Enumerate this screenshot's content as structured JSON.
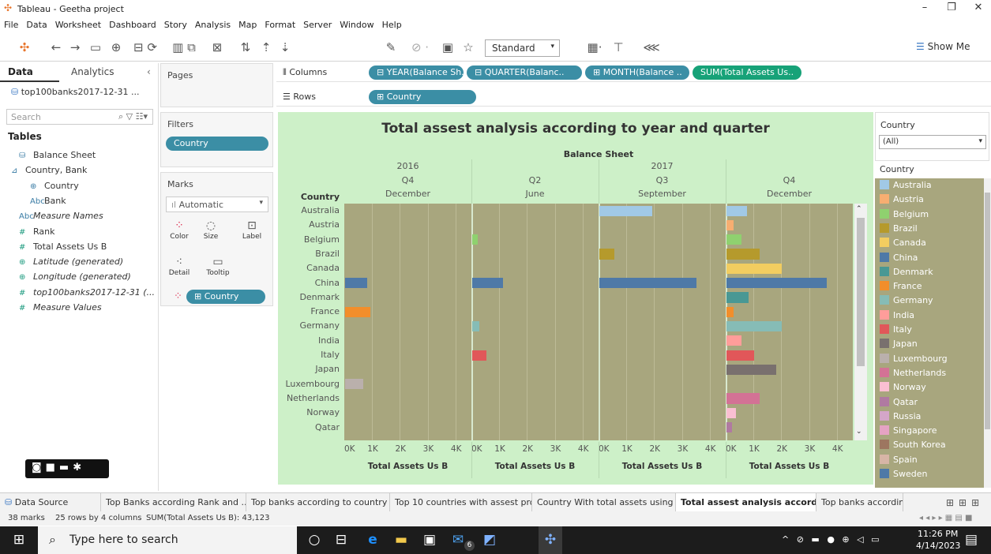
{
  "window": {
    "title": "Tableau - Geetha project"
  },
  "menu": [
    "File",
    "Data",
    "Worksheet",
    "Dashboard",
    "Story",
    "Analysis",
    "Map",
    "Format",
    "Server",
    "Window",
    "Help"
  ],
  "toolbar": {
    "fit": "Standard",
    "show_me": "Show Me"
  },
  "left_panel": {
    "tab_data": "Data",
    "tab_analytics": "Analytics",
    "datasource": "top100banks2017-12-31 ...",
    "search_placeholder": "Search",
    "tables_heading": "Tables",
    "fields": [
      {
        "icon": "table-icon",
        "label": "Balance Sheet",
        "italic": false,
        "measure": false
      },
      {
        "icon": "hierarchy-icon",
        "label": "Country, Bank",
        "italic": false,
        "measure": false
      },
      {
        "icon": "globe-icon",
        "label": "Country",
        "italic": false,
        "measure": false
      },
      {
        "icon": "abc-icon",
        "label": "Bank",
        "italic": false,
        "measure": false
      },
      {
        "icon": "abc-icon",
        "label": "Measure Names",
        "italic": true,
        "measure": false
      },
      {
        "icon": "number-icon",
        "label": "Rank",
        "italic": false,
        "measure": true
      },
      {
        "icon": "number-icon",
        "label": "Total Assets Us B",
        "italic": false,
        "measure": true
      },
      {
        "icon": "globe-icon",
        "label": "Latitude (generated)",
        "italic": true,
        "measure": true
      },
      {
        "icon": "globe-icon",
        "label": "Longitude (generated)",
        "italic": true,
        "measure": true
      },
      {
        "icon": "number-icon",
        "label": "top100banks2017-12-31 (...",
        "italic": true,
        "measure": true
      },
      {
        "icon": "number-icon",
        "label": "Measure Values",
        "italic": true,
        "measure": true
      }
    ]
  },
  "cards": {
    "pages": "Pages",
    "filters": "Filters",
    "filter_pill": "Country",
    "marks": "Marks",
    "mark_type": "Automatic",
    "mark_buttons": [
      "Color",
      "Size",
      "Label",
      "Detail",
      "Tooltip"
    ],
    "marks_pill": "Country"
  },
  "shelves": {
    "columns_label": "Columns",
    "rows_label": "Rows",
    "columns": [
      "YEAR(Balance Sh..",
      "QUARTER(Balanc..",
      "MONTH(Balance ..",
      "SUM(Total Assets Us.."
    ],
    "rows": [
      "Country"
    ]
  },
  "chart_data": {
    "type": "bar",
    "title": "Total assest analysis according to year and quarter",
    "header_title": "Balance Sheet",
    "row_header": "Country",
    "panes": [
      {
        "year": "2016",
        "quarter": "Q4",
        "month": "December"
      },
      {
        "year": "",
        "quarter": "Q2",
        "month": "June"
      },
      {
        "year": "2017",
        "quarter": "Q3",
        "month": "September"
      },
      {
        "year": "",
        "quarter": "Q4",
        "month": "December"
      }
    ],
    "year_headers": [
      "2016",
      "2017"
    ],
    "categories": [
      "Australia",
      "Austria",
      "Belgium",
      "Brazil",
      "Canada",
      "China",
      "Denmark",
      "France",
      "Germany",
      "India",
      "Italy",
      "Japan",
      "Luxembourg",
      "Netherlands",
      "Norway",
      "Qatar"
    ],
    "colors": [
      "#a1c9e6",
      "#f7ae71",
      "#8fd16f",
      "#b59a2c",
      "#f2cd60",
      "#4e79a7",
      "#499894",
      "#f28e2b",
      "#86bcb6",
      "#ff9d9a",
      "#e15759",
      "#79706e",
      "#bab0ac",
      "#d37295",
      "#fabfd2",
      "#b07aa1"
    ],
    "series": [
      {
        "name": "2016 Q4 December",
        "values": [
          0,
          0,
          0,
          0,
          0,
          800,
          0,
          900,
          0,
          0,
          0,
          0,
          650,
          0,
          0,
          0
        ]
      },
      {
        "name": "2017 Q2 June",
        "values": [
          0,
          0,
          200,
          0,
          0,
          1100,
          0,
          0,
          250,
          0,
          500,
          0,
          0,
          0,
          0,
          0
        ]
      },
      {
        "name": "2017 Q3 September",
        "values": [
          1900,
          0,
          0,
          550,
          0,
          3500,
          0,
          0,
          0,
          0,
          0,
          0,
          0,
          0,
          0,
          0
        ]
      },
      {
        "name": "2017 Q4 December",
        "values": [
          750,
          250,
          550,
          1200,
          2000,
          3600,
          800,
          250,
          2000,
          550,
          1000,
          1800,
          0,
          1200,
          350,
          200
        ]
      }
    ],
    "xlim": [
      0,
      4400
    ],
    "x_ticks": [
      "0K",
      "1K",
      "2K",
      "3K",
      "4K"
    ],
    "x_tick_values": [
      0,
      1000,
      2000,
      3000,
      4000
    ],
    "xlabel": "Total Assets Us B",
    "ylabel": "Country"
  },
  "legend": {
    "title": "Country",
    "filter_title": "Country",
    "filter_value": "(All)",
    "items": [
      {
        "label": "Australia",
        "color": "#a1c9e6"
      },
      {
        "label": "Austria",
        "color": "#f7ae71"
      },
      {
        "label": "Belgium",
        "color": "#8fd16f"
      },
      {
        "label": "Brazil",
        "color": "#b59a2c"
      },
      {
        "label": "Canada",
        "color": "#f2cd60"
      },
      {
        "label": "China",
        "color": "#4e79a7"
      },
      {
        "label": "Denmark",
        "color": "#499894"
      },
      {
        "label": "France",
        "color": "#f28e2b"
      },
      {
        "label": "Germany",
        "color": "#86bcb6"
      },
      {
        "label": "India",
        "color": "#ff9d9a"
      },
      {
        "label": "Italy",
        "color": "#e15759"
      },
      {
        "label": "Japan",
        "color": "#79706e"
      },
      {
        "label": "Luxembourg",
        "color": "#bab0ac"
      },
      {
        "label": "Netherlands",
        "color": "#d37295"
      },
      {
        "label": "Norway",
        "color": "#fabfd2"
      },
      {
        "label": "Qatar",
        "color": "#b07aa1"
      },
      {
        "label": "Russia",
        "color": "#d4a6c8"
      },
      {
        "label": "Singapore",
        "color": "#e5a3c3"
      },
      {
        "label": "South Korea",
        "color": "#9d7660"
      },
      {
        "label": "Spain",
        "color": "#d7b5a6"
      },
      {
        "label": "Sweden",
        "color": "#4e79a7"
      }
    ]
  },
  "sheet_tabs": [
    {
      "label": "Data Source",
      "active": false
    },
    {
      "label": "Top Banks according Rank and ...",
      "active": false
    },
    {
      "label": "Top banks according to country ...",
      "active": false
    },
    {
      "label": "Top 10 countries with assest pro...",
      "active": false
    },
    {
      "label": "Country With total assets using f...",
      "active": false
    },
    {
      "label": "Total assest analysis accordin...",
      "active": true
    },
    {
      "label": "Top banks according to",
      "active": false
    }
  ],
  "status": {
    "marks": "38 marks",
    "rows_cols": "25 rows by 4 columns",
    "sum": "SUM(Total Assets Us B): 43,123"
  },
  "taskbar": {
    "search_placeholder": "Type here to search",
    "time": "11:26 PM",
    "date": "4/14/2023",
    "badge": "6"
  }
}
